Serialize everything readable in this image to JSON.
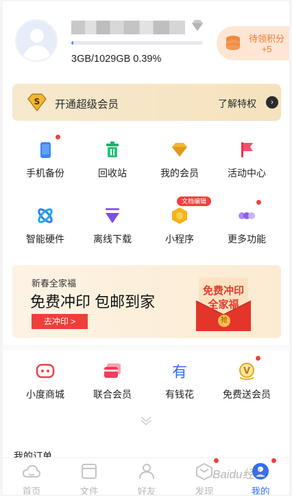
{
  "profile": {
    "username": "••••••••••••••",
    "storage_text": "3GB/1029GB   0.39%",
    "storage_fraction": 0.0039,
    "points_label": "待领积分",
    "points_value": "+5"
  },
  "vip_banner": {
    "title": "开通超级会员",
    "more_label": "了解特权",
    "arrow": "›"
  },
  "grid": [
    {
      "label": "手机备份",
      "icon": "phone-backup-icon",
      "badge": true
    },
    {
      "label": "回收站",
      "icon": "recycle-bin-icon",
      "badge": false
    },
    {
      "label": "我的会员",
      "icon": "diamond-icon",
      "badge": false
    },
    {
      "label": "活动中心",
      "icon": "flag-icon",
      "badge": false
    },
    {
      "label": "智能硬件",
      "icon": "smart-hardware-icon",
      "badge": false
    },
    {
      "label": "离线下载",
      "icon": "offline-download-icon",
      "badge": false
    },
    {
      "label": "小程序",
      "icon": "mini-program-icon",
      "badge": false,
      "tag": "文档编辑"
    },
    {
      "label": "更多功能",
      "icon": "more-functions-icon",
      "badge": true
    }
  ],
  "promo": {
    "sub": "新春全家福",
    "headline": "免费冲印 包邮到家",
    "button": "去冲印 >",
    "envelope_line1": "免费冲印",
    "envelope_line2": "全家福",
    "envelope_button": "抢"
  },
  "services": [
    {
      "label": "小度商城",
      "icon": "xiaodu-mall-icon",
      "badge": false
    },
    {
      "label": "联合会员",
      "icon": "joint-member-card-icon",
      "badge": false
    },
    {
      "label": "有钱花",
      "icon": "youqianhua-icon",
      "badge": false
    },
    {
      "label": "免费送会员",
      "icon": "free-member-gift-icon",
      "badge": true
    }
  ],
  "orders_label": "我的订单",
  "tabs": [
    {
      "label": "首页",
      "icon": "home-cloud-icon",
      "active": false
    },
    {
      "label": "文件",
      "icon": "folder-icon",
      "active": false
    },
    {
      "label": "好友",
      "icon": "friends-icon",
      "active": false
    },
    {
      "label": "发现",
      "icon": "discover-icon",
      "active": false
    },
    {
      "label": "我的",
      "icon": "profile-icon",
      "active": true
    }
  ],
  "watermark": "Baidu经验",
  "colors": {
    "accent": "#2f6ef5",
    "badge_red": "#f0413c",
    "points_orange": "#ee7a2c",
    "vip_gold": "#f5e2bd"
  }
}
